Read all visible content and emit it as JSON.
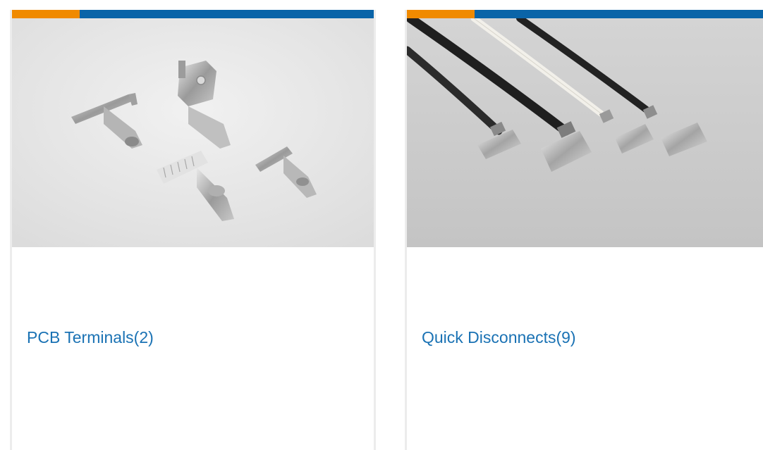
{
  "colors": {
    "accent_orange": "#f08a00",
    "accent_blue": "#0a64a8",
    "title_link": "#1a72b4",
    "card_border": "#ececec"
  },
  "cards": [
    {
      "title": "PCB Terminals(2)",
      "image_subject": "assorted metal pcb terminal pins on light background"
    },
    {
      "title": "Quick Disconnects(9)",
      "image_subject": "insulated wires with crimped quick-disconnect terminals on grey background"
    }
  ]
}
